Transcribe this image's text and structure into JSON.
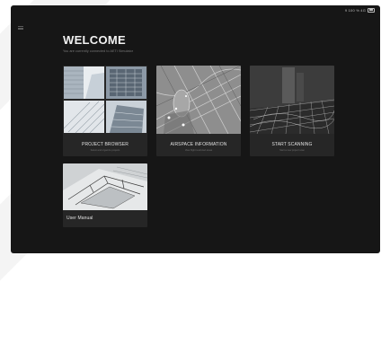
{
  "header": {
    "title": "WELCOME",
    "subtitle": "You are currently connected to AETI Simulator"
  },
  "status": {
    "text": "9 100 % 4G"
  },
  "cards": [
    {
      "label": "PROJECT BROWSER",
      "sub": "Select and organize projects"
    },
    {
      "label": "AIRSPACE INFORMATION",
      "sub": "View flight restricted areas"
    },
    {
      "label": "START SCANNING",
      "sub": "Start a new project scan"
    },
    {
      "label": "User Manual",
      "sub": ""
    }
  ]
}
